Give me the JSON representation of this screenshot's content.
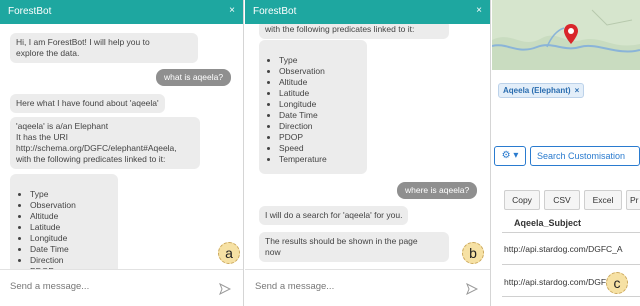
{
  "chat": {
    "app_name": "ForestBot",
    "close_glyph": "×",
    "input_placeholder": "Send a message..."
  },
  "panel_a": {
    "badge": "a",
    "msg1": "Hi, I am ForestBot! I will help you to\nexplore the data.",
    "user1": "what is aqeela?",
    "msg2": "Here what I have found about 'aqeela'",
    "msg3": "'aqeela' is a/an Elephant\nIt has the URI\nhttp://schema.org/DGFC/elephant#Aqeela,\nwith the following predicates linked to it:",
    "predicates": [
      "Type",
      "Observation",
      "Altitude",
      "Latitude",
      "Longitude",
      "Date Time",
      "Direction",
      "PDOP"
    ]
  },
  "panel_b": {
    "badge": "b",
    "msg_top": "with the following predicates linked to it:",
    "predicates": [
      "Type",
      "Observation",
      "Altitude",
      "Latitude",
      "Longitude",
      "Date Time",
      "Direction",
      "PDOP",
      "Speed",
      "Temperature"
    ],
    "user1": "where is aqeela?",
    "msg2": "I will do a search for 'aqeela' for you.",
    "msg3": "The results should be shown in the page\nnow"
  },
  "panel_c": {
    "badge": "c",
    "filter_tag": "Aqeela (Elephant)",
    "filter_remove": "×",
    "gear_label": "⚙ ▾",
    "search_button": "Search Customisation",
    "export": [
      "Copy",
      "CSV",
      "Excel",
      "Pr"
    ],
    "column_header": "Aqeela_Subject",
    "rows": [
      "http://api.stardog.com/DGFC_A",
      "http://api.stardog.com/DGFC_A"
    ]
  },
  "colors": {
    "header": "#1ea7a0",
    "bot_bubble": "#ececec",
    "user_bubble": "#8f8f8f",
    "accent_blue": "#2a7bcf"
  }
}
